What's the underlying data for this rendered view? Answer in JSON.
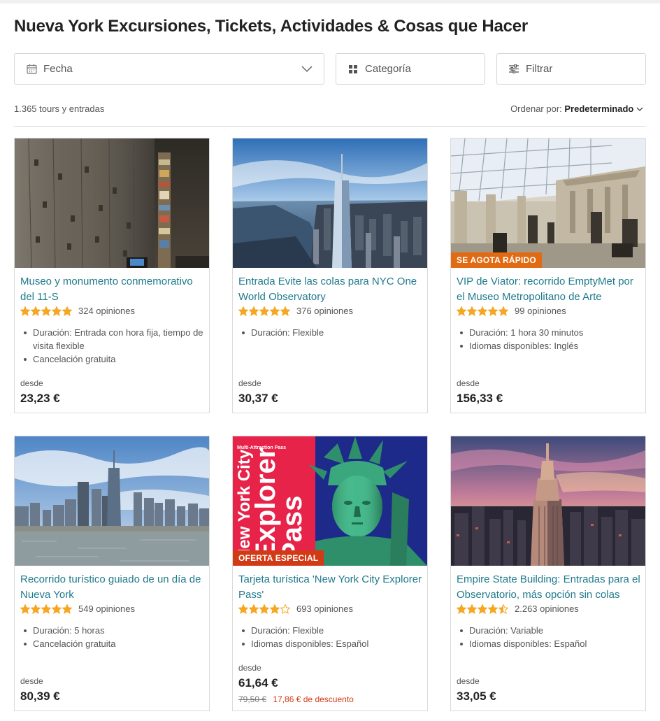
{
  "page": {
    "title": "Nueva York Excursiones, Tickets, Actividades & Cosas que Hacer"
  },
  "filters": {
    "date_label": "Fecha",
    "category_label": "Categoría",
    "filter_label": "Filtrar"
  },
  "results": {
    "count_text": "1.365 tours y entradas",
    "sort_prefix": "Ordenar por:",
    "sort_value": "Predeterminado"
  },
  "colors": {
    "link": "#1f7a8c",
    "star": "#f5a623",
    "badge_orange": "#e26a12",
    "badge_red": "#d23a16"
  },
  "cards": [
    {
      "title": "Museo y monumento conmemorativo del 11-S",
      "rating": 5,
      "reviews": "324 opiniones",
      "details": [
        "Duración: Entrada con hora fija, tiempo de visita flexible",
        "Cancelación gratuita"
      ],
      "from": "desde",
      "price": "23,23 €",
      "badge": "",
      "image": "memorial-wall-photo"
    },
    {
      "title": "Entrada Evite las colas para NYC One World Observatory",
      "rating": 5,
      "reviews": "376 opiniones",
      "details": [
        "Duración: Flexible"
      ],
      "from": "desde",
      "price": "30,37 €",
      "badge": "",
      "image": "one-world-aerial-photo"
    },
    {
      "title": "VIP de Viator: recorrido EmptyMet por el Museo Metropolitano de Arte",
      "rating": 5,
      "reviews": "99 opiniones",
      "details": [
        "Duración: 1 hora 30 minutos",
        "Idiomas disponibles: Inglés"
      ],
      "from": "desde",
      "price": "156,33 €",
      "badge": "SE AGOTA RÁPIDO",
      "image": "met-museum-hall-photo"
    },
    {
      "title": "Recorrido turístico guiado de un día de Nueva York",
      "rating": 5,
      "reviews": "549 opiniones",
      "details": [
        "Duración: 5 horas",
        "Cancelación gratuita"
      ],
      "from": "desde",
      "price": "80,39 €",
      "badge": "",
      "image": "skyline-water-photo"
    },
    {
      "title": "Tarjeta turística 'New York City Explorer Pass'",
      "rating": 4,
      "reviews": "693 opiniones",
      "details": [
        "Duración: Flexible",
        "Idiomas disponibles: Español"
      ],
      "from": "desde",
      "price": "61,64 €",
      "old_price": "79,50 €",
      "discount": "17,86 € de descuento",
      "badge": "OFERTA ESPECIAL",
      "image": "explorer-pass-liberty-photo",
      "image_text": {
        "small": "Multi-Attraction Pass",
        "line1": "New York City",
        "line2": "Explorer",
        "line3": "Pass"
      }
    },
    {
      "title": "Empire State Building: Entradas para el Observatorio, más opción sin colas",
      "rating": 4.5,
      "reviews": "2.263 opiniones",
      "details": [
        "Duración: Variable",
        "Idiomas disponibles: Español"
      ],
      "from": "desde",
      "price": "33,05 €",
      "badge": "",
      "image": "empire-state-sunset-photo"
    }
  ]
}
